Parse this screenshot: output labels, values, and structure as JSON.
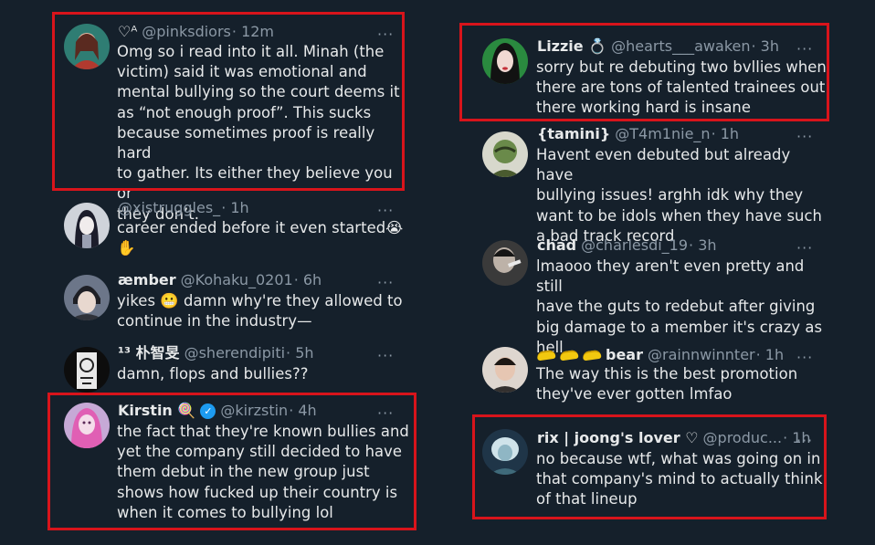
{
  "left_tweets": [
    {
      "display_name": "",
      "badge": "♡ᴬ",
      "handle": "@pinksdiors",
      "time": "· 12m",
      "body": "Omg so i read into it all. Minah (the\nvictim) said it was emotional and\nmental bullying so the court deems it\nas “not enough proof”. This sucks\nbecause sometimes proof is really hard\nto gather. Its either they believe you or\nthey don’t."
    },
    {
      "display_name": "",
      "handle": "@xistruggles_",
      "time": "· 1h",
      "body": "career ended before it even started😭\n✋"
    },
    {
      "display_name": "æmber",
      "handle": "@Kohaku_0201",
      "time": "· 6h",
      "body": "yikes 😬 damn why're they allowed to\ncontinue in the industry—"
    },
    {
      "display_name": "¹³ 朴智旻",
      "handle": "@sherendipiti",
      "time": "· 5h",
      "body": "damn, flops and bullies??"
    },
    {
      "display_name": "Kirstin 🍭",
      "handle": "@kirzstin",
      "time": "· 4h",
      "body": "the fact that they're known bullies and\nyet the company still decided to have\nthem debut in the new group just\nshows how fucked up their country is\nwhen it comes to bullying lol"
    }
  ],
  "right_tweets": [
    {
      "display_name": "Lizzie 💍",
      "handle": "@hearts___awaken",
      "time": "· 3h",
      "body": "sorry but re debuting two bvllies when\nthere are tons of talented trainees out\nthere working hard is insane"
    },
    {
      "display_name": "{tamini}",
      "handle": "@T4m1nie_n",
      "time": "· 1h",
      "body": "Havent even debuted but already have\nbullying issues! arghh idk why they\nwant to be idols when they have such\na bad track record"
    },
    {
      "display_name": "chad",
      "handle": "@charlesdi_19",
      "time": "· 3h",
      "body": "lmaooo they aren't even pretty and still\nhave the guts to redebut after giving\nbig damage to a member it's crazy as\nhell"
    },
    {
      "display_name": "bear",
      "handle": "@rainnwinnter",
      "time": "· 1h",
      "body": "The way this is the best promotion\nthey've ever gotten lmfao"
    },
    {
      "display_name": "rix | joong's lover ♡",
      "handle": "@produc...",
      "time": "· 1h",
      "body": "no because wtf, what was going on in\nthat company's mind to actually think\nof that lineup"
    }
  ],
  "more_label": "···",
  "verified_mark": "✓",
  "colors": {
    "background": "#15202b",
    "text": "#e7e9ea",
    "muted": "#8b98a5",
    "highlight_box": "#d8141b",
    "verified": "#1d9bf0"
  },
  "icons": [
    "more-options-icon",
    "verified-badge-icon",
    "banana-emoji-icon"
  ]
}
